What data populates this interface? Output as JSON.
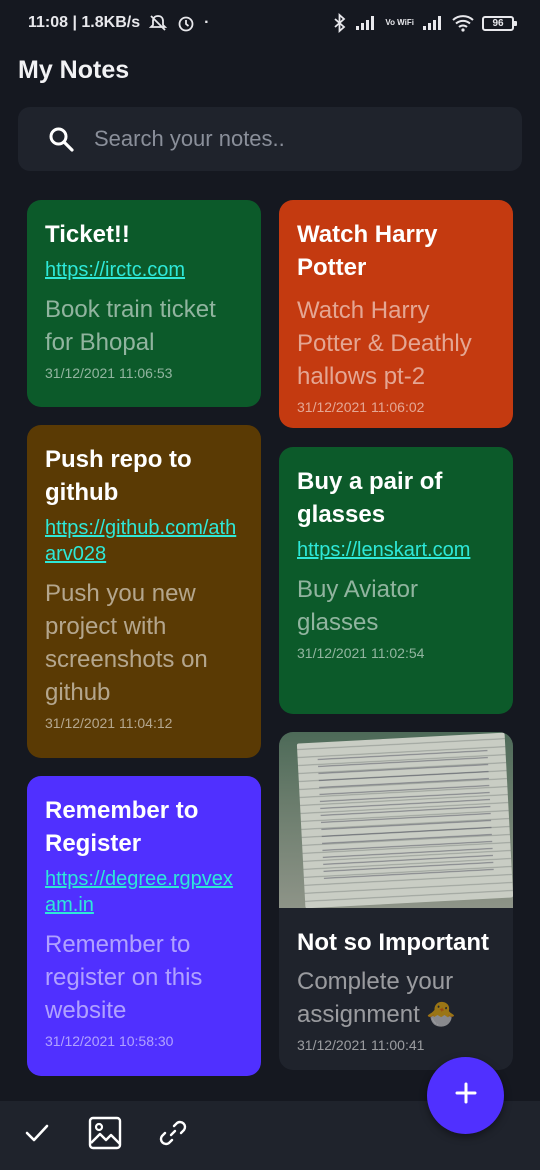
{
  "status_bar": {
    "time_speed": "11:08 | 1.8KB/s",
    "dot": "·",
    "vowifi": "Vo WiFi",
    "battery": "96"
  },
  "header": {
    "title": "My Notes"
  },
  "search": {
    "placeholder": "Search your notes.."
  },
  "notes": [
    {
      "title": "Ticket!!",
      "link": "https://irctc.com",
      "body": "Book train ticket for Bhopal",
      "date": "31/12/2021 11:06:53",
      "color": "#0c5a2a"
    },
    {
      "title": "Watch Harry Potter",
      "body": "Watch Harry Potter & Deathly hallows pt-2",
      "date": "31/12/2021 11:06:02",
      "color": "#c43a10"
    },
    {
      "title": "Push repo to github",
      "link": "https://github.com/atharv028",
      "body": "Push you new project with screenshots on github",
      "date": "31/12/2021 11:04:12",
      "color": "#5a3a04"
    },
    {
      "title": "Buy a pair of glasses",
      "link": "https://lenskart.com",
      "body": "Buy Aviator glasses",
      "date": "31/12/2021 11:02:54",
      "color": "#0c5a2a"
    },
    {
      "title": "Remember to Register",
      "link": "https://degree.rgpvexam.in",
      "body": "Remember to register on this website",
      "date": "31/12/2021 10:58:30",
      "color": "#5030ff"
    },
    {
      "title": "Not so Important",
      "body": "Complete your assignment 🐣",
      "date": "31/12/2021 11:00:41",
      "color": "#1f232c"
    }
  ],
  "icons": {
    "search": "search-icon",
    "check": "check-icon",
    "image": "image-icon",
    "link": "link-icon",
    "add": "plus-icon"
  },
  "colors": {
    "background": "#151820",
    "surface": "#1f232c",
    "accent": "#5030ff",
    "link": "#2ee8d8"
  }
}
